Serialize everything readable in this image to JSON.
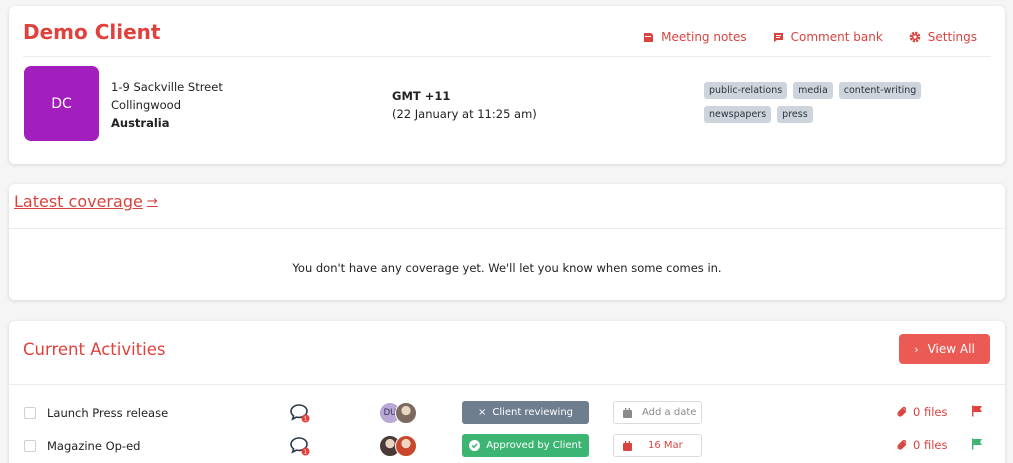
{
  "client": {
    "name": "Demo Client",
    "initials": "DC",
    "avatar_color": "#a31fbd",
    "address": {
      "line1": "1-9 Sackville Street",
      "line2": "Collingwood",
      "country": "Australia"
    },
    "timezone": "GMT +11",
    "local_time": "(22 January at 11:25 am)",
    "tags": [
      "public-relations",
      "media",
      "content-writing",
      "newspapers",
      "press"
    ],
    "actions": {
      "meeting_notes": "Meeting notes",
      "comment_bank": "Comment bank",
      "settings": "Settings"
    }
  },
  "coverage": {
    "title": "Latest coverage",
    "arrow": "→",
    "empty_message": "You don't have any coverage yet. We'll let you know when some comes in."
  },
  "activities": {
    "title": "Current Activities",
    "view_all": "View All",
    "rows": [
      {
        "name": "Launch Press release",
        "assignee_initials": "DU",
        "status": "Client reviewing",
        "status_color": "#6e7e8f",
        "date": "Add a date",
        "files": "0 files",
        "flag_color": "#e0413c"
      },
      {
        "name": "Magazine Op-ed",
        "status": "Approved by Client",
        "status_color": "#3cb572",
        "date": "16 Mar",
        "files": "0 files",
        "flag_color": "#3cb572"
      }
    ]
  },
  "colors": {
    "accent": "#e0413c",
    "button": "#ec5a55",
    "tag_bg": "#ced4dc"
  }
}
